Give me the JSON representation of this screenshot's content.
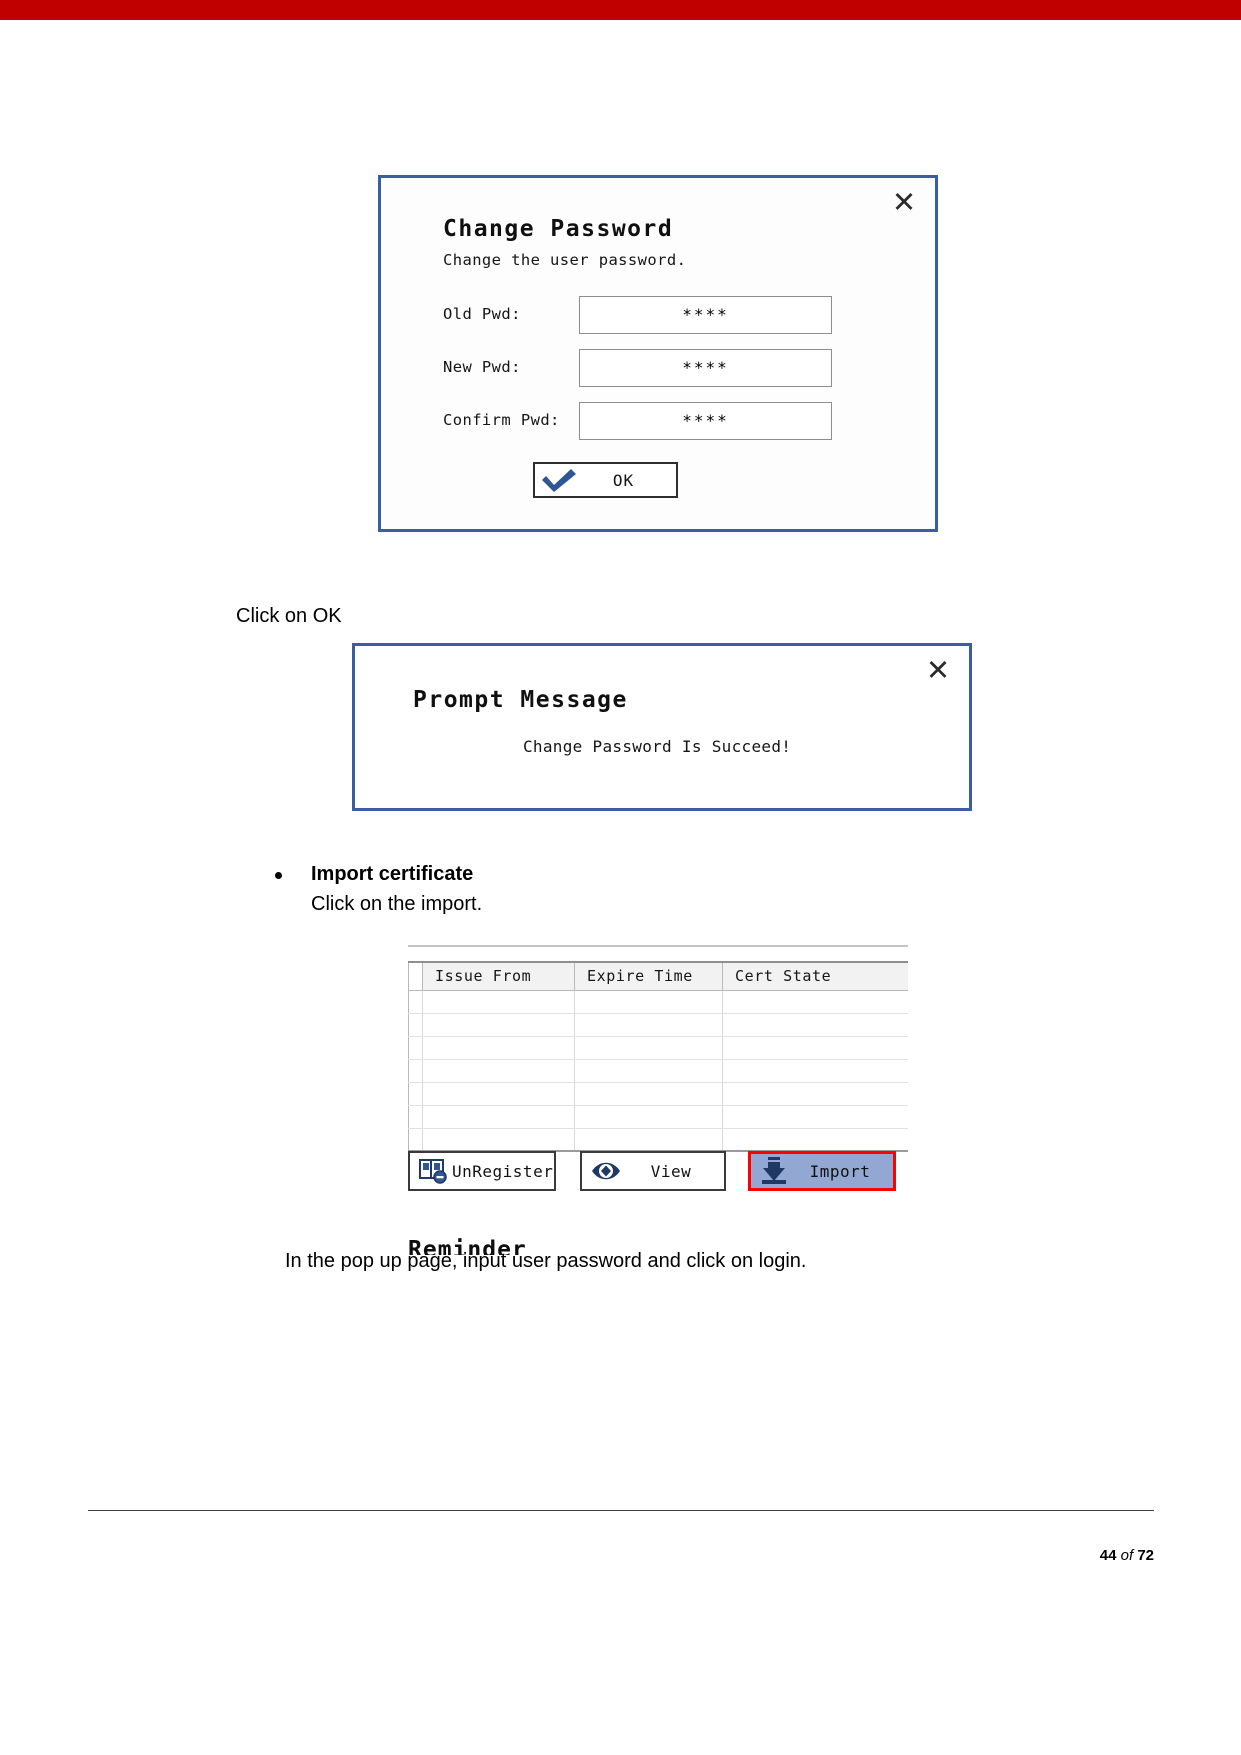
{
  "page": {
    "band_color": "#c00000",
    "footer": {
      "page_number": "44",
      "of_label": "of",
      "total_pages": "72"
    }
  },
  "change_password_dialog": {
    "close_icon": "close-x-icon",
    "title": "Change Password",
    "subtitle": "Change the user password.",
    "fields": [
      {
        "label": "Old Pwd:",
        "value": "****"
      },
      {
        "label": "New Pwd:",
        "value": "****"
      },
      {
        "label": "Confirm Pwd:",
        "value": "****"
      }
    ],
    "ok_button": {
      "label": "OK",
      "icon": "checkmark-icon",
      "icon_color": "#2f5597"
    },
    "border_color": "#3b5ea0"
  },
  "captions": {
    "click_on_ok": "Click on OK",
    "popup_instruction": "In the pop up page, input user password and click on login."
  },
  "prompt_dialog": {
    "close_icon": "close-x-icon",
    "title": "Prompt Message",
    "message": "Change Password Is Succeed!",
    "border_color": "#3b5ea0"
  },
  "import_section": {
    "bullet_heading": "Import certificate",
    "bullet_sub": "Click on the import.",
    "table": {
      "columns": [
        "Issue From",
        "Expire Time",
        "Cert State"
      ],
      "rows": [
        [
          "",
          "",
          ""
        ],
        [
          "",
          "",
          ""
        ],
        [
          "",
          "",
          ""
        ],
        [
          "",
          "",
          ""
        ],
        [
          "",
          "",
          ""
        ],
        [
          "",
          "",
          ""
        ],
        [
          "",
          "",
          ""
        ]
      ]
    },
    "buttons": [
      {
        "label": "UnRegister",
        "icon": "book-unregister-icon",
        "highlighted": false
      },
      {
        "label": "View",
        "icon": "eye-icon",
        "highlighted": false
      },
      {
        "label": "Import",
        "icon": "download-arrow-icon",
        "highlighted": true,
        "highlight_color": "#ff0000",
        "fill_color": "#92a8d2"
      }
    ],
    "reminder_label": "Reminder"
  }
}
